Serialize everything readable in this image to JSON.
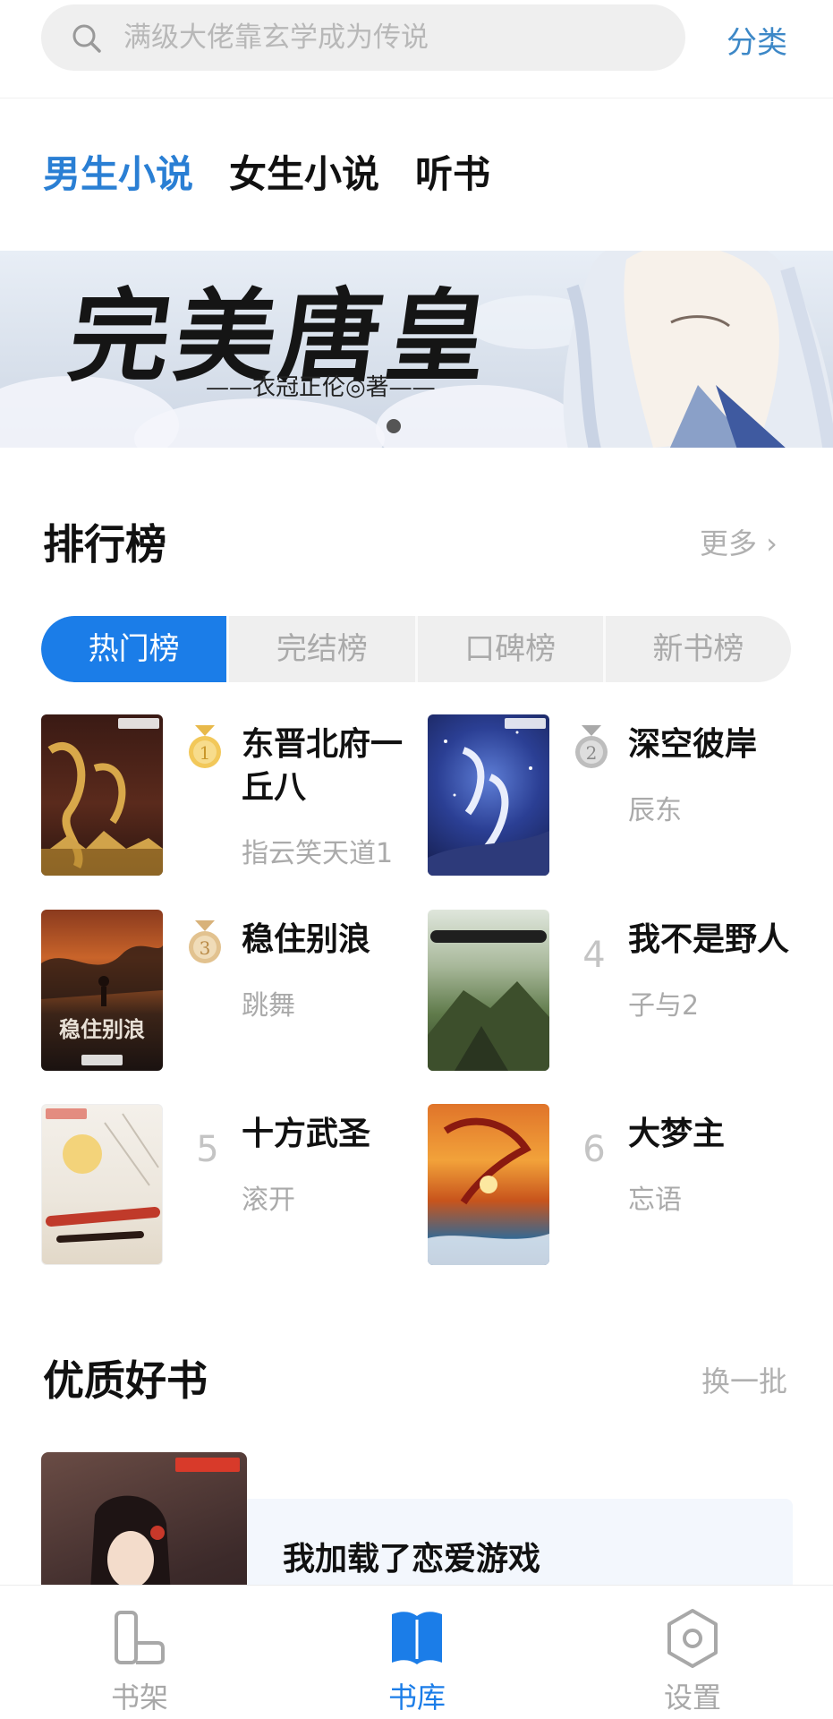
{
  "search": {
    "placeholder": "满级大佬靠玄学成为传说",
    "category_label": "分类"
  },
  "channels": [
    {
      "label": "男生小说",
      "active": true
    },
    {
      "label": "女生小说",
      "active": false
    },
    {
      "label": "听书",
      "active": false
    }
  ],
  "banner": {
    "title": "完美唐皇",
    "author": "——衣冠正伦◎著——",
    "active_slide_index": 0
  },
  "ranking": {
    "title": "排行榜",
    "more_label": "更多 ›",
    "tabs": [
      {
        "label": "热门榜",
        "active": true
      },
      {
        "label": "完结榜",
        "active": false
      },
      {
        "label": "口碑榜",
        "active": false
      },
      {
        "label": "新书榜",
        "active": false
      }
    ],
    "books": [
      {
        "rank": "1",
        "title": "东晋北府一丘八",
        "author": "指云笑天道1",
        "medal": "gold"
      },
      {
        "rank": "2",
        "title": "深空彼岸",
        "author": "辰东",
        "medal": "silver"
      },
      {
        "rank": "3",
        "title": "稳住别浪",
        "author": "跳舞",
        "medal": "bronze"
      },
      {
        "rank": "4",
        "title": "我不是野人",
        "author": "子与2",
        "medal": "none"
      },
      {
        "rank": "5",
        "title": "十方武圣",
        "author": "滚开",
        "medal": "none"
      },
      {
        "rank": "6",
        "title": "大梦主",
        "author": "忘语",
        "medal": "none"
      }
    ]
  },
  "quality": {
    "title": "优质好书",
    "refresh_label": "换一批",
    "featured_title": "我加载了恋爱游戏"
  },
  "nav": [
    {
      "label": "书架",
      "icon": "bookshelf-icon",
      "active": false
    },
    {
      "label": "书库",
      "icon": "library-icon",
      "active": true
    },
    {
      "label": "设置",
      "icon": "settings-hexagon-icon",
      "active": false
    }
  ],
  "colors": {
    "accent": "#1b7de8",
    "channel_active": "#2a7fd4",
    "link": "#3d88c7",
    "muted": "#aaaaaa",
    "gold": "#e8b94a",
    "silver": "#b3b3b3",
    "bronze": "#e2c28f"
  }
}
